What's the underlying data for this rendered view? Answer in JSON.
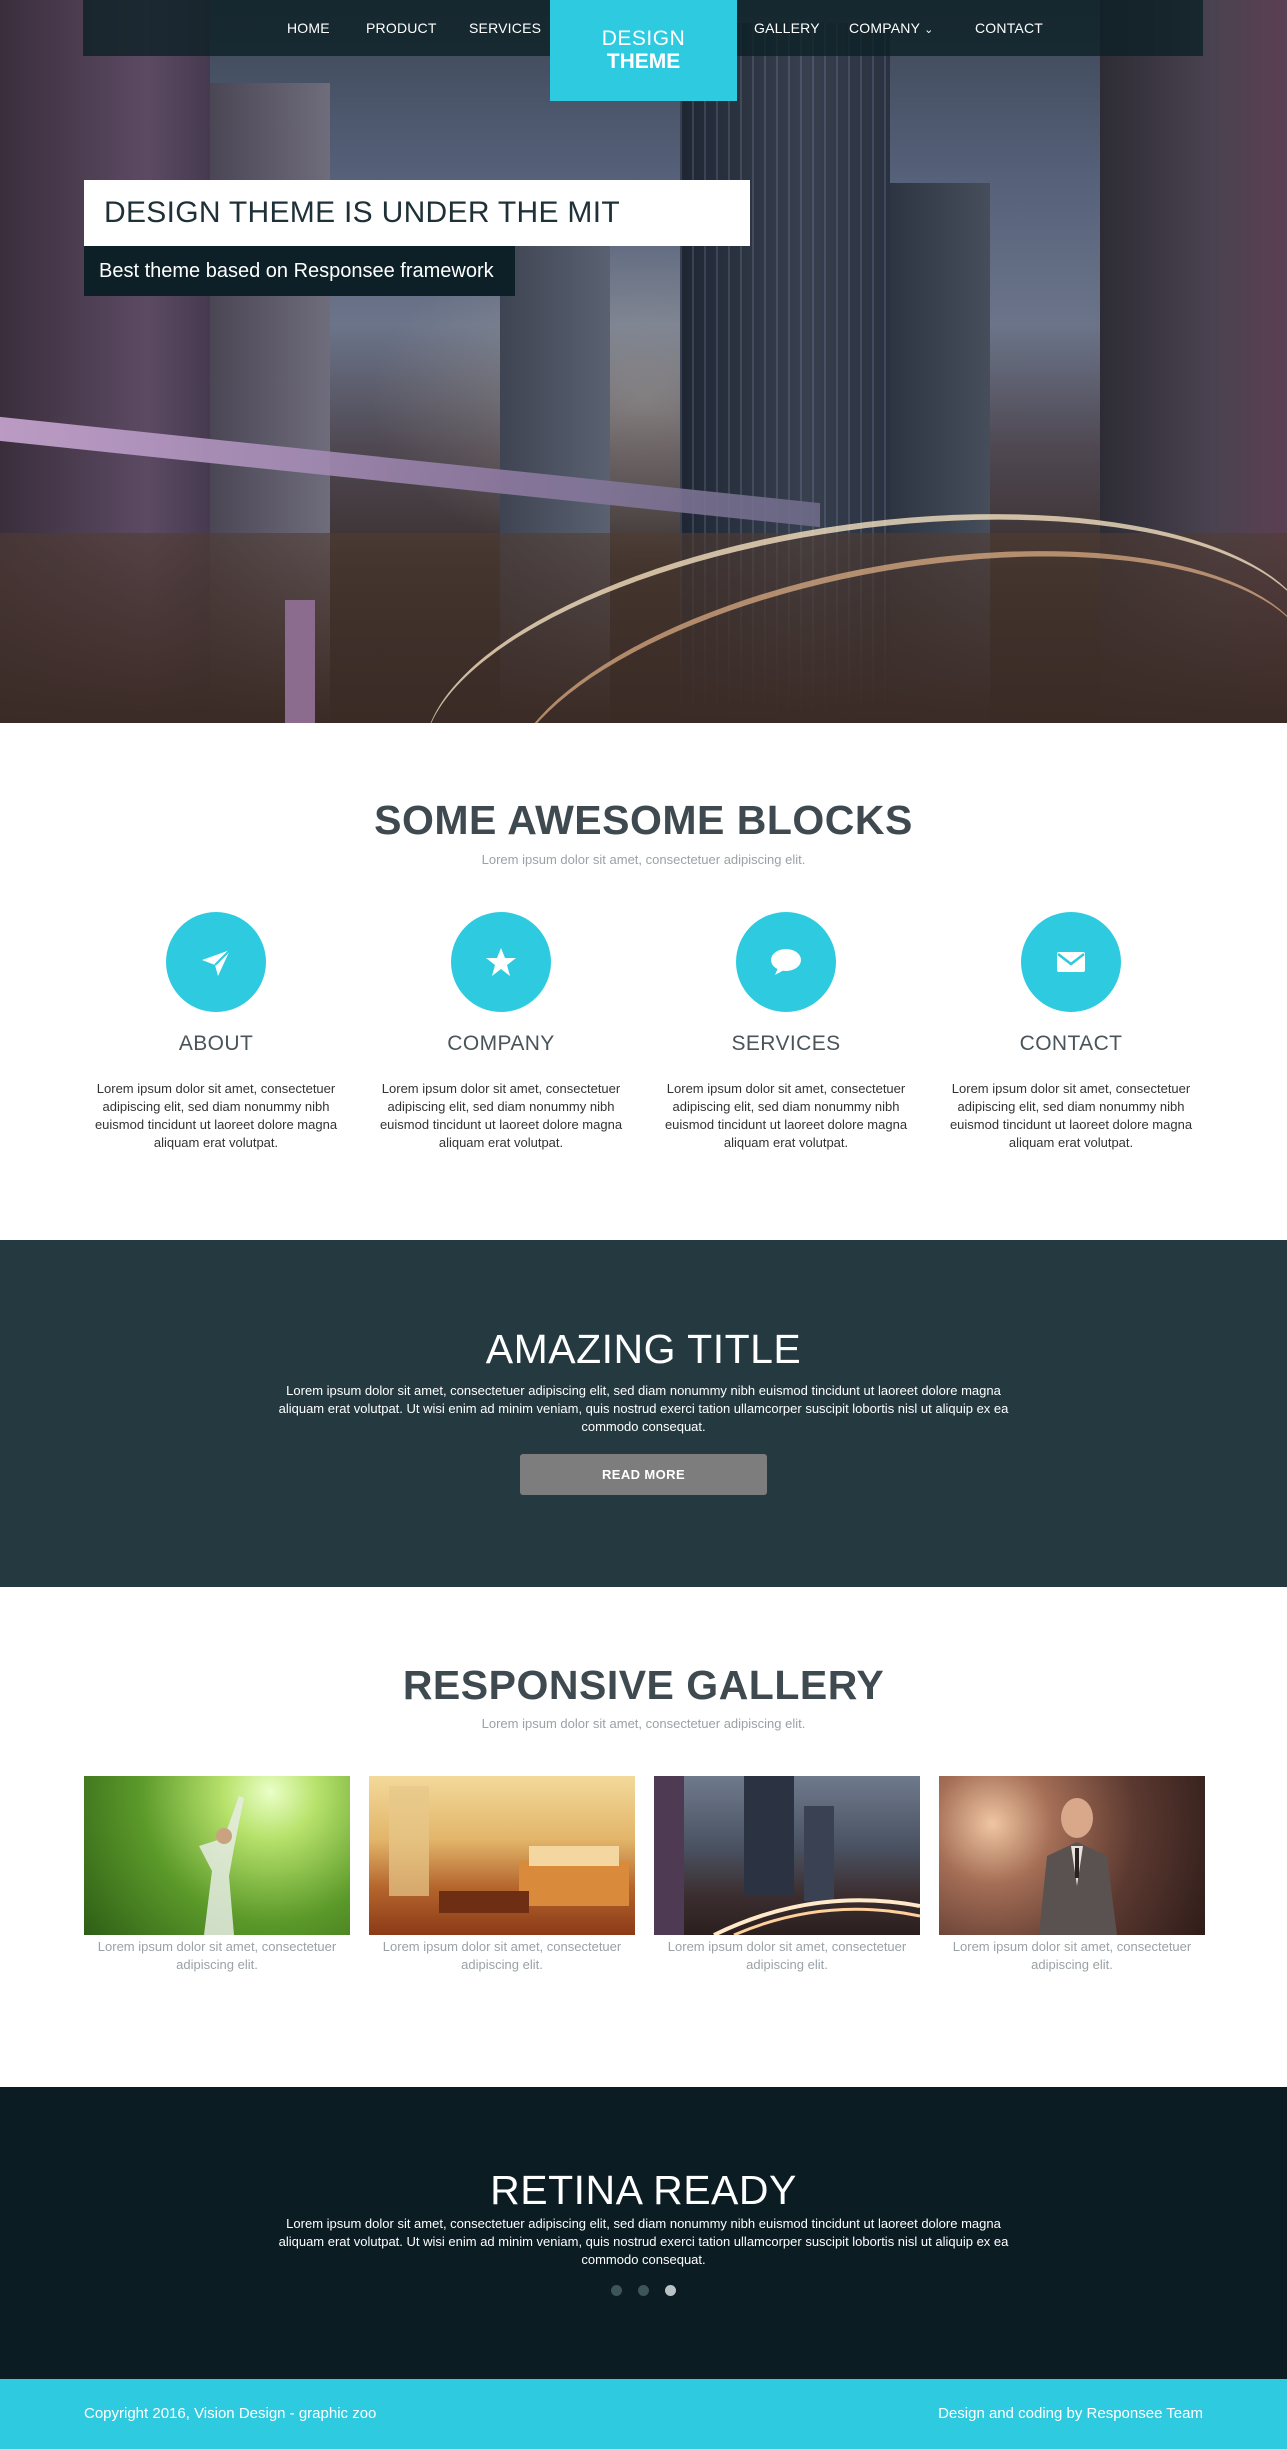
{
  "nav": {
    "items_left": [
      "HOME",
      "PRODUCT",
      "SERVICES"
    ],
    "items_right": [
      "GALLERY",
      "COMPANY",
      "CONTACT"
    ],
    "logo_line1": "DESIGN",
    "logo_line2": "THEME"
  },
  "hero": {
    "title": "DESIGN THEME IS UNDER THE MIT LICENSE",
    "subtitle": "Best theme based on Responsee framework"
  },
  "blocks": {
    "title": "SOME AWESOME BLOCKS",
    "subtitle": "Lorem ipsum dolor sit amet, consectetuer adipiscing elit.",
    "items": [
      {
        "title": "ABOUT",
        "icon": "paper-plane-icon",
        "text": "Lorem ipsum dolor sit amet, consectetuer adipiscing elit, sed diam nonummy nibh euismod tincidunt ut laoreet dolore magna aliquam erat volutpat."
      },
      {
        "title": "COMPANY",
        "icon": "star-icon",
        "text": "Lorem ipsum dolor sit amet, consectetuer adipiscing elit, sed diam nonummy nibh euismod tincidunt ut laoreet dolore magna aliquam erat volutpat."
      },
      {
        "title": "SERVICES",
        "icon": "speech-bubble-icon",
        "text": "Lorem ipsum dolor sit amet, consectetuer adipiscing elit, sed diam nonummy nibh euismod tincidunt ut laoreet dolore magna aliquam erat volutpat."
      },
      {
        "title": "CONTACT",
        "icon": "envelope-icon",
        "text": "Lorem ipsum dolor sit amet, consectetuer adipiscing elit, sed diam nonummy nibh euismod tincidunt ut laoreet dolore magna aliquam erat volutpat."
      }
    ]
  },
  "amazing": {
    "title": "AMAZING TITLE",
    "text": "Lorem ipsum dolor sit amet, consectetuer adipiscing elit, sed diam nonummy nibh euismod tincidunt ut laoreet dolore magna aliquam erat volutpat. Ut wisi enim ad minim veniam, quis nostrud exerci tation ullamcorper suscipit lobortis nisl ut aliquip ex ea commodo consequat.",
    "button": "READ MORE"
  },
  "gallery": {
    "title": "RESPONSIVE GALLERY",
    "subtitle": "Lorem ipsum dolor sit amet, consectetuer adipiscing elit.",
    "captions": [
      "Lorem ipsum dolor sit amet, consectetuer adipiscing elit.",
      "Lorem ipsum dolor sit amet, consectetuer adipiscing elit.",
      "Lorem ipsum dolor sit amet, consectetuer adipiscing elit.",
      "Lorem ipsum dolor sit amet, consectetuer adipiscing elit."
    ]
  },
  "retina": {
    "title": "RETINA READY",
    "text": "Lorem ipsum dolor sit amet, consectetuer adipiscing elit, sed diam nonummy nibh euismod tincidunt ut laoreet dolore magna aliquam erat volutpat. Ut wisi enim ad minim veniam, quis nostrud exerci tation ullamcorper suscipit lobortis nisl ut aliquip ex ea commodo consequat.",
    "active_slide": 3,
    "slide_count": 3
  },
  "footer": {
    "copyright": "Copyright 2016, Vision Design - graphic zoo",
    "credit": "Design and coding by Responsee Team"
  },
  "colors": {
    "accent": "#2ecbe0",
    "dark_section": "#243a40",
    "darker_section": "#0b1c22",
    "button": "#7d7d7d"
  }
}
